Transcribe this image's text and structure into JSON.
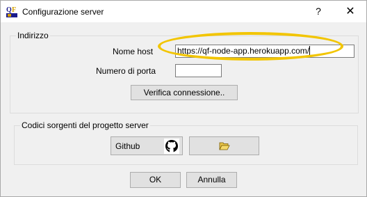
{
  "window": {
    "title": "Configurazione server",
    "help_label": "?",
    "close_label": "✕",
    "app_icon": "qf-app-icon"
  },
  "address_group": {
    "legend": "Indirizzo",
    "host_label": "Nome host",
    "host_value": "https://qf-node-app.herokuapp.com/",
    "port_label": "Numero di porta",
    "port_value": "",
    "verify_label": "Verifica connessione.."
  },
  "source_group": {
    "legend": "Codici sorgenti del progetto server",
    "github_label": "Github",
    "github_icon": "github-icon",
    "folder_icon": "open-folder-icon"
  },
  "footer": {
    "ok_label": "OK",
    "cancel_label": "Annulla"
  },
  "colors": {
    "highlight": "#f2c500",
    "background": "#f0f0f0"
  }
}
